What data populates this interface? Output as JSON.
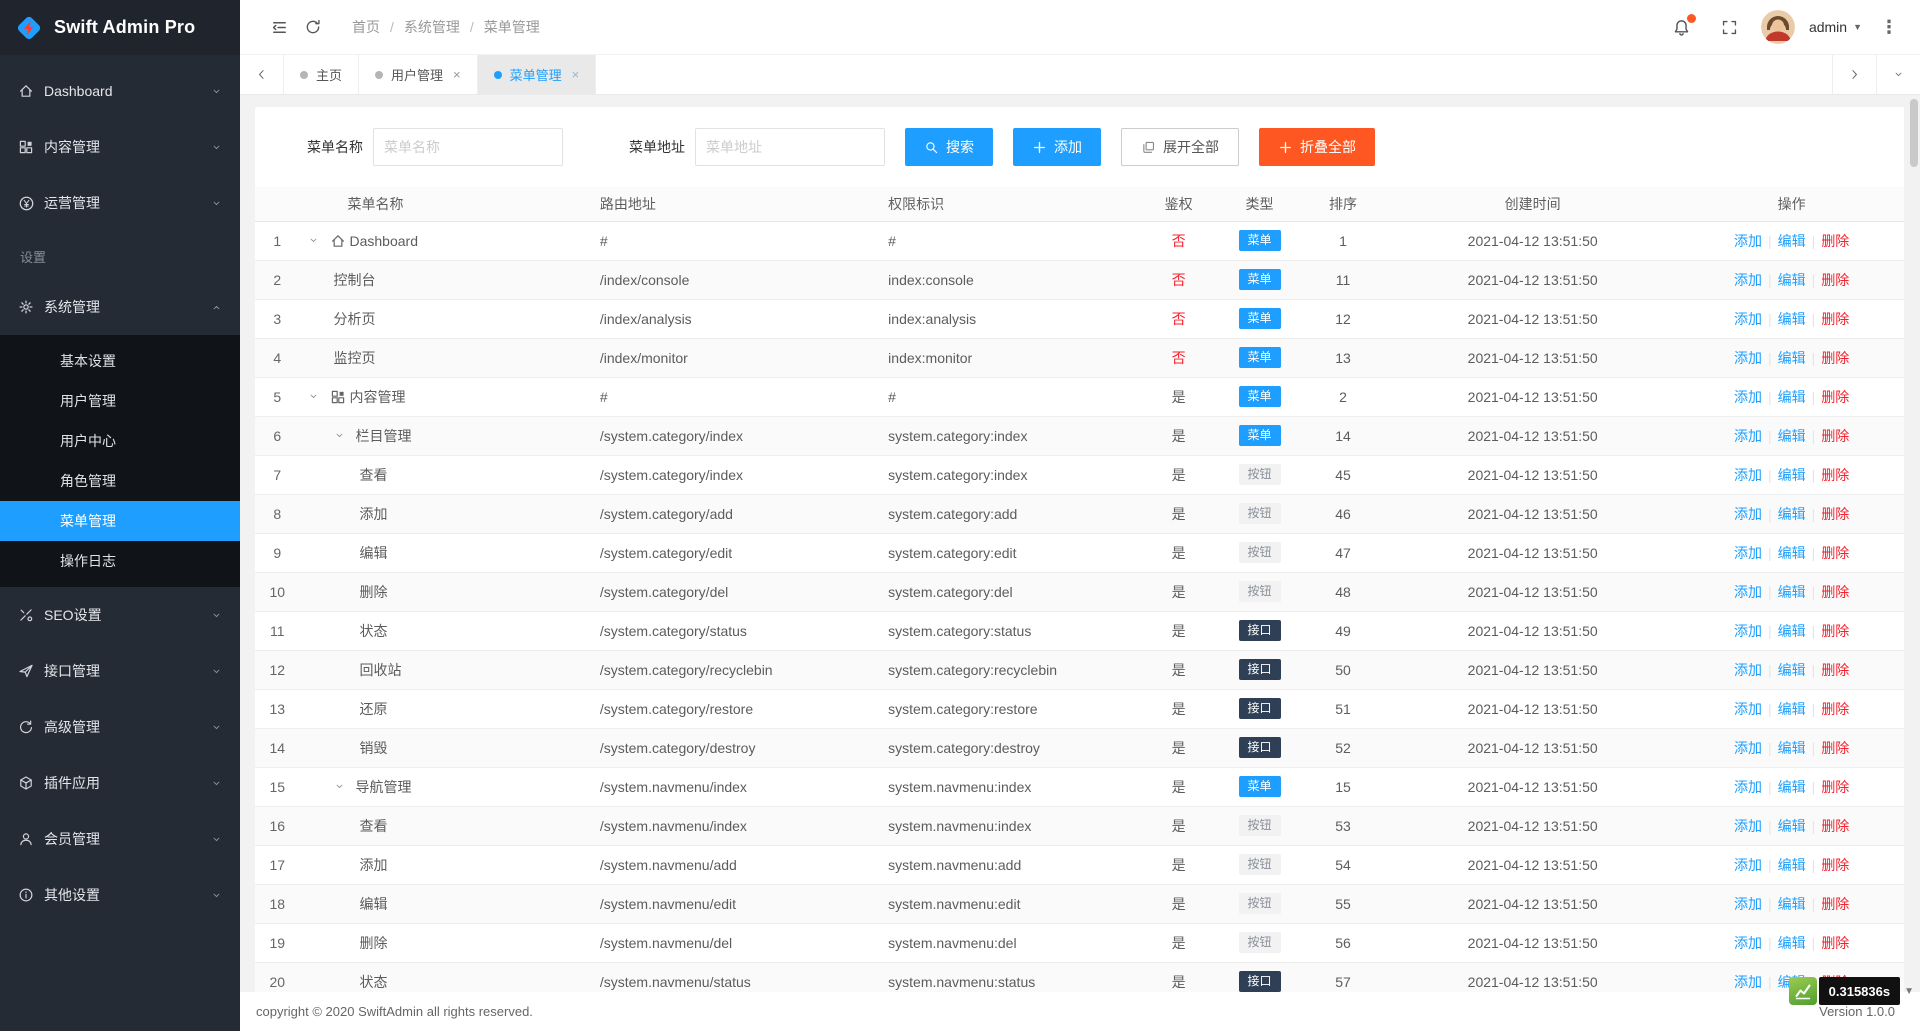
{
  "app": {
    "title": "Swift Admin Pro",
    "copyright": "copyright © 2020 SwiftAdmin all rights reserved.",
    "version": "Version 1.0.0",
    "load_time": "0.315836s",
    "colors": {
      "accent_blue": "#1e9fff",
      "orange": "#ff5722",
      "danger_red": "#f5222d",
      "badge_api": "#2f4056",
      "sidebar_bg": "#252b35",
      "submenu_bg": "#101318"
    }
  },
  "sidebar": {
    "section_label": "设置",
    "items_top": [
      {
        "label": "Dashboard",
        "icon": "home-icon"
      },
      {
        "label": "内容管理",
        "icon": "grid-icon"
      },
      {
        "label": "运营管理",
        "icon": "yen-icon"
      }
    ],
    "system_item": {
      "label": "系统管理",
      "icon": "gear-icon"
    },
    "submenu": [
      {
        "label": "基本设置",
        "active": false
      },
      {
        "label": "用户管理",
        "active": false
      },
      {
        "label": "用户中心",
        "active": false
      },
      {
        "label": "角色管理",
        "active": false
      },
      {
        "label": "菜单管理",
        "active": true
      },
      {
        "label": "操作日志",
        "active": false
      }
    ],
    "items_bottom": [
      {
        "label": "SEO设置",
        "icon": "tools-icon"
      },
      {
        "label": "接口管理",
        "icon": "send-icon"
      },
      {
        "label": "高级管理",
        "icon": "advanced-icon"
      },
      {
        "label": "插件应用",
        "icon": "plugin-icon"
      },
      {
        "label": "会员管理",
        "icon": "member-icon"
      },
      {
        "label": "其他设置",
        "icon": "other-icon"
      }
    ]
  },
  "header": {
    "breadcrumb": [
      "首页",
      "系统管理",
      "菜单管理"
    ],
    "user": "admin"
  },
  "tabs": [
    {
      "label": "主页",
      "closable": false,
      "active": false
    },
    {
      "label": "用户管理",
      "closable": true,
      "active": false
    },
    {
      "label": "菜单管理",
      "closable": true,
      "active": true
    }
  ],
  "toolbar": {
    "name_label": "菜单名称",
    "name_placeholder": "菜单名称",
    "name_value": "",
    "url_label": "菜单地址",
    "url_placeholder": "菜单地址",
    "url_value": "",
    "search_label": "搜索",
    "add_label": "添加",
    "expand_all_label": "展开全部",
    "collapse_all_label": "折叠全部"
  },
  "table": {
    "headers": [
      "菜单名称",
      "路由地址",
      "权限标识",
      "鉴权",
      "类型",
      "排序",
      "创建时间",
      "操作"
    ],
    "actions": [
      {
        "label": "添加",
        "color": "blue"
      },
      {
        "label": "编辑",
        "color": "blue"
      },
      {
        "label": "删除",
        "color": "red"
      }
    ],
    "rows": [
      {
        "num": 1,
        "arrow": true,
        "icon": "home-icon",
        "indent": 0,
        "name": "Dashboard",
        "path": "#",
        "perm": "#",
        "auth": "否",
        "type": "菜单",
        "sort": "1",
        "created": "2021-04-12 13:51:50"
      },
      {
        "num": 2,
        "arrow": false,
        "icon": "",
        "indent": 1,
        "name": "控制台",
        "path": "/index/console",
        "perm": "index:console",
        "auth": "否",
        "type": "菜单",
        "sort": "11",
        "created": "2021-04-12 13:51:50"
      },
      {
        "num": 3,
        "arrow": false,
        "icon": "",
        "indent": 1,
        "name": "分析页",
        "path": "/index/analysis",
        "perm": "index:analysis",
        "auth": "否",
        "type": "菜单",
        "sort": "12",
        "created": "2021-04-12 13:51:50"
      },
      {
        "num": 4,
        "arrow": false,
        "icon": "",
        "indent": 1,
        "name": "监控页",
        "path": "/index/monitor",
        "perm": "index:monitor",
        "auth": "否",
        "type": "菜单",
        "sort": "13",
        "created": "2021-04-12 13:51:50"
      },
      {
        "num": 5,
        "arrow": true,
        "icon": "grid-icon",
        "indent": 0,
        "name": "内容管理",
        "path": "#",
        "perm": "#",
        "auth": "是",
        "type": "菜单",
        "sort": "2",
        "created": "2021-04-12 13:51:50"
      },
      {
        "num": 6,
        "arrow": true,
        "icon": "",
        "indent": 1,
        "name": "栏目管理",
        "path": "/system.category/index",
        "perm": "system.category:index",
        "auth": "是",
        "type": "菜单",
        "sort": "14",
        "created": "2021-04-12 13:51:50"
      },
      {
        "num": 7,
        "arrow": false,
        "icon": "",
        "indent": 2,
        "name": "查看",
        "path": "/system.category/index",
        "perm": "system.category:index",
        "auth": "是",
        "type": "按钮",
        "sort": "45",
        "created": "2021-04-12 13:51:50"
      },
      {
        "num": 8,
        "arrow": false,
        "icon": "",
        "indent": 2,
        "name": "添加",
        "path": "/system.category/add",
        "perm": "system.category:add",
        "auth": "是",
        "type": "按钮",
        "sort": "46",
        "created": "2021-04-12 13:51:50"
      },
      {
        "num": 9,
        "arrow": false,
        "icon": "",
        "indent": 2,
        "name": "编辑",
        "path": "/system.category/edit",
        "perm": "system.category:edit",
        "auth": "是",
        "type": "按钮",
        "sort": "47",
        "created": "2021-04-12 13:51:50"
      },
      {
        "num": 10,
        "arrow": false,
        "icon": "",
        "indent": 2,
        "name": "删除",
        "path": "/system.category/del",
        "perm": "system.category:del",
        "auth": "是",
        "type": "按钮",
        "sort": "48",
        "created": "2021-04-12 13:51:50"
      },
      {
        "num": 11,
        "arrow": false,
        "icon": "",
        "indent": 2,
        "name": "状态",
        "path": "/system.category/status",
        "perm": "system.category:status",
        "auth": "是",
        "type": "接口",
        "sort": "49",
        "created": "2021-04-12 13:51:50"
      },
      {
        "num": 12,
        "arrow": false,
        "icon": "",
        "indent": 2,
        "name": "回收站",
        "path": "/system.category/recyclebin",
        "perm": "system.category:recyclebin",
        "auth": "是",
        "type": "接口",
        "sort": "50",
        "created": "2021-04-12 13:51:50"
      },
      {
        "num": 13,
        "arrow": false,
        "icon": "",
        "indent": 2,
        "name": "还原",
        "path": "/system.category/restore",
        "perm": "system.category:restore",
        "auth": "是",
        "type": "接口",
        "sort": "51",
        "created": "2021-04-12 13:51:50"
      },
      {
        "num": 14,
        "arrow": false,
        "icon": "",
        "indent": 2,
        "name": "销毁",
        "path": "/system.category/destroy",
        "perm": "system.category:destroy",
        "auth": "是",
        "type": "接口",
        "sort": "52",
        "created": "2021-04-12 13:51:50"
      },
      {
        "num": 15,
        "arrow": true,
        "icon": "",
        "indent": 1,
        "name": "导航管理",
        "path": "/system.navmenu/index",
        "perm": "system.navmenu:index",
        "auth": "是",
        "type": "菜单",
        "sort": "15",
        "created": "2021-04-12 13:51:50"
      },
      {
        "num": 16,
        "arrow": false,
        "icon": "",
        "indent": 2,
        "name": "查看",
        "path": "/system.navmenu/index",
        "perm": "system.navmenu:index",
        "auth": "是",
        "type": "按钮",
        "sort": "53",
        "created": "2021-04-12 13:51:50"
      },
      {
        "num": 17,
        "arrow": false,
        "icon": "",
        "indent": 2,
        "name": "添加",
        "path": "/system.navmenu/add",
        "perm": "system.navmenu:add",
        "auth": "是",
        "type": "按钮",
        "sort": "54",
        "created": "2021-04-12 13:51:50"
      },
      {
        "num": 18,
        "arrow": false,
        "icon": "",
        "indent": 2,
        "name": "编辑",
        "path": "/system.navmenu/edit",
        "perm": "system.navmenu:edit",
        "auth": "是",
        "type": "按钮",
        "sort": "55",
        "created": "2021-04-12 13:51:50"
      },
      {
        "num": 19,
        "arrow": false,
        "icon": "",
        "indent": 2,
        "name": "删除",
        "path": "/system.navmenu/del",
        "perm": "system.navmenu:del",
        "auth": "是",
        "type": "按钮",
        "sort": "56",
        "created": "2021-04-12 13:51:50"
      },
      {
        "num": 20,
        "arrow": false,
        "icon": "",
        "indent": 2,
        "name": "状态",
        "path": "/system.navmenu/status",
        "perm": "system.navmenu:status",
        "auth": "是",
        "type": "接口",
        "sort": "57",
        "created": "2021-04-12 13:51:50"
      }
    ]
  }
}
